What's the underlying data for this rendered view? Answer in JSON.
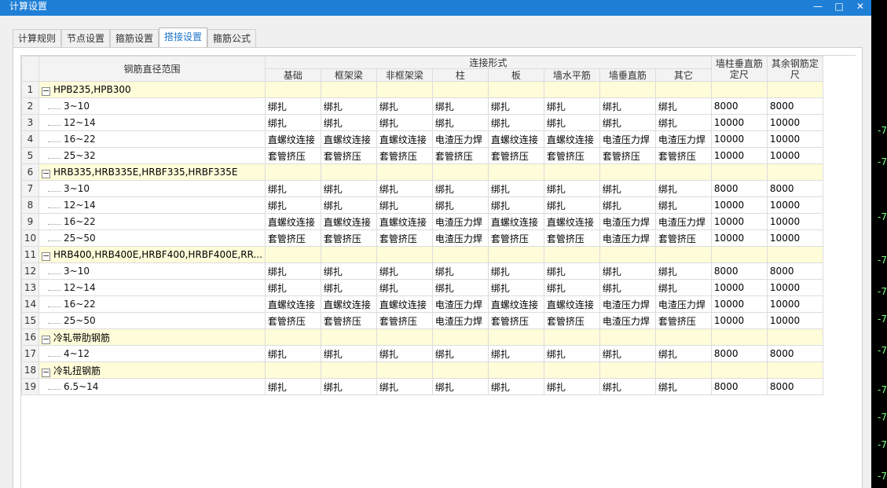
{
  "window": {
    "title": "计算设置",
    "minimize_glyph": "—",
    "maximize_glyph": "□",
    "close_glyph": "✕"
  },
  "tabs": [
    {
      "label": "计算规则",
      "active": false
    },
    {
      "label": "节点设置",
      "active": false
    },
    {
      "label": "箍筋设置",
      "active": false
    },
    {
      "label": "搭接设置",
      "active": true
    },
    {
      "label": "箍筋公式",
      "active": false
    }
  ],
  "table": {
    "header": {
      "range": "钢筋直径范围",
      "connection": "连接形式",
      "columns": [
        "基础",
        "框架梁",
        "非框架梁",
        "柱",
        "板",
        "墙水平筋",
        "墙垂直筋",
        "其它"
      ],
      "wall_col": "墙柱垂直筋定尺",
      "other_len": "其余钢筋定尺"
    },
    "rows": [
      {
        "n": "1",
        "group": true,
        "name": "HPB235,HPB300"
      },
      {
        "n": "2",
        "range": "3~10",
        "cells": [
          "绑扎",
          "绑扎",
          "绑扎",
          "绑扎",
          "绑扎",
          "绑扎",
          "绑扎",
          "绑扎"
        ],
        "wall": "8000",
        "other": "8000"
      },
      {
        "n": "3",
        "range": "12~14",
        "cells": [
          "绑扎",
          "绑扎",
          "绑扎",
          "绑扎",
          "绑扎",
          "绑扎",
          "绑扎",
          "绑扎"
        ],
        "wall": "10000",
        "other": "10000"
      },
      {
        "n": "4",
        "range": "16~22",
        "cells": [
          "直螺纹连接",
          "直螺纹连接",
          "直螺纹连接",
          "电渣压力焊",
          "直螺纹连接",
          "直螺纹连接",
          "电渣压力焊",
          "电渣压力焊"
        ],
        "wall": "10000",
        "other": "10000"
      },
      {
        "n": "5",
        "range": "25~32",
        "cells": [
          "套管挤压",
          "套管挤压",
          "套管挤压",
          "套管挤压",
          "套管挤压",
          "套管挤压",
          "套管挤压",
          "套管挤压"
        ],
        "wall": "10000",
        "other": "10000"
      },
      {
        "n": "6",
        "group": true,
        "name": "HRB335,HRB335E,HRBF335,HRBF335E"
      },
      {
        "n": "7",
        "range": "3~10",
        "cells": [
          "绑扎",
          "绑扎",
          "绑扎",
          "绑扎",
          "绑扎",
          "绑扎",
          "绑扎",
          "绑扎"
        ],
        "wall": "8000",
        "other": "8000"
      },
      {
        "n": "8",
        "range": "12~14",
        "cells": [
          "绑扎",
          "绑扎",
          "绑扎",
          "绑扎",
          "绑扎",
          "绑扎",
          "绑扎",
          "绑扎"
        ],
        "wall": "10000",
        "other": "10000"
      },
      {
        "n": "9",
        "range": "16~22",
        "cells": [
          "直螺纹连接",
          "直螺纹连接",
          "直螺纹连接",
          "电渣压力焊",
          "直螺纹连接",
          "直螺纹连接",
          "电渣压力焊",
          "电渣压力焊"
        ],
        "wall": "10000",
        "other": "10000"
      },
      {
        "n": "10",
        "range": "25~50",
        "cells": [
          "套管挤压",
          "套管挤压",
          "套管挤压",
          "电渣压力焊",
          "套管挤压",
          "套管挤压",
          "电渣压力焊",
          "套管挤压"
        ],
        "wall": "10000",
        "other": "10000"
      },
      {
        "n": "11",
        "group": true,
        "name": "HRB400,HRB400E,HRBF400,HRBF400E,RR..."
      },
      {
        "n": "12",
        "range": "3~10",
        "cells": [
          "绑扎",
          "绑扎",
          "绑扎",
          "绑扎",
          "绑扎",
          "绑扎",
          "绑扎",
          "绑扎"
        ],
        "wall": "8000",
        "other": "8000"
      },
      {
        "n": "13",
        "range": "12~14",
        "cells": [
          "绑扎",
          "绑扎",
          "绑扎",
          "绑扎",
          "绑扎",
          "绑扎",
          "绑扎",
          "绑扎"
        ],
        "wall": "10000",
        "other": "10000"
      },
      {
        "n": "14",
        "range": "16~22",
        "cells": [
          "直螺纹连接",
          "直螺纹连接",
          "直螺纹连接",
          "电渣压力焊",
          "直螺纹连接",
          "直螺纹连接",
          "电渣压力焊",
          "电渣压力焊"
        ],
        "wall": "10000",
        "other": "10000"
      },
      {
        "n": "15",
        "range": "25~50",
        "cells": [
          "套管挤压",
          "套管挤压",
          "套管挤压",
          "电渣压力焊",
          "套管挤压",
          "套管挤压",
          "电渣压力焊",
          "套管挤压"
        ],
        "wall": "10000",
        "other": "10000"
      },
      {
        "n": "16",
        "group": true,
        "name": "冷轧带肋钢筋"
      },
      {
        "n": "17",
        "range": "4~12",
        "cells": [
          "绑扎",
          "绑扎",
          "绑扎",
          "绑扎",
          "绑扎",
          "绑扎",
          "绑扎",
          "绑扎"
        ],
        "wall": "8000",
        "other": "8000"
      },
      {
        "n": "18",
        "group": true,
        "name": "冷轧扭钢筋"
      },
      {
        "n": "19",
        "range": "6.5~14",
        "cells": [
          "绑扎",
          "绑扎",
          "绑扎",
          "绑扎",
          "绑扎",
          "绑扎",
          "绑扎",
          "绑扎"
        ],
        "wall": "8000",
        "other": "8000"
      }
    ],
    "toggle_glyph": "−"
  },
  "background_marks": [
    "-7",
    "-7",
    "-7",
    "-7",
    "-7",
    "-7",
    "-7",
    "-7",
    "-7",
    "-7",
    "-7",
    "-7",
    "-7",
    "-7"
  ]
}
